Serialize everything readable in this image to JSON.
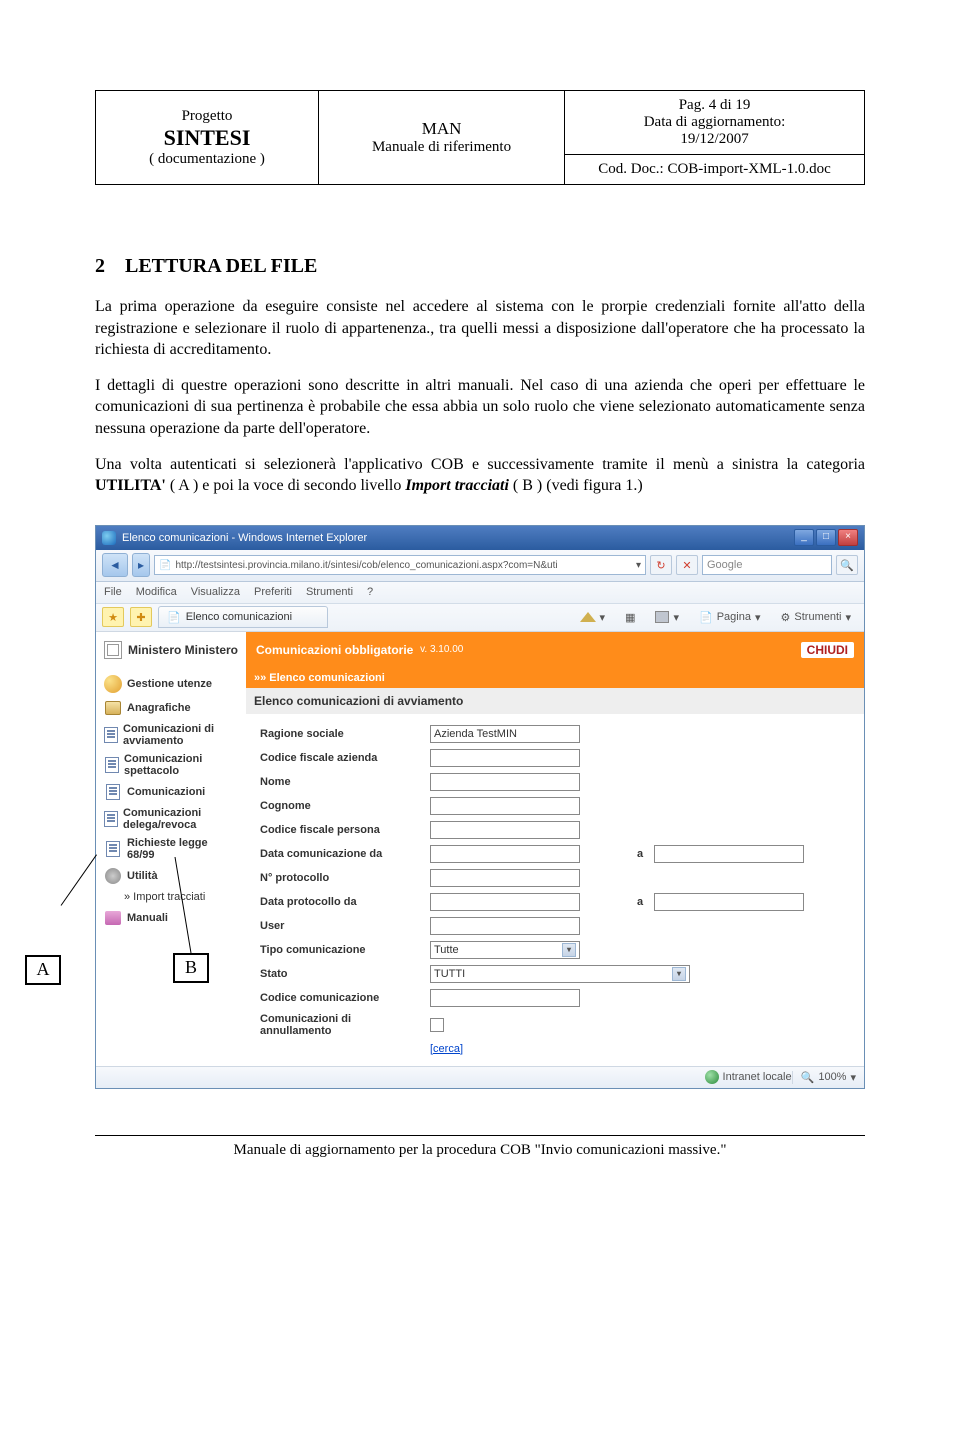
{
  "header": {
    "project_label": "Progetto",
    "project_name": "SINTESI",
    "project_sub": "( documentazione )",
    "man": "MAN",
    "man_sub": "Manuale di riferimento",
    "page": "Pag. 4 di 19",
    "update_label": "Data di aggiornamento:",
    "update_date": "19/12/2007",
    "code": "Cod. Doc.: COB-import-XML-1.0.doc"
  },
  "section": {
    "num": "2",
    "title": "LETTURA DEL FILE"
  },
  "paragraphs": {
    "p1": "La prima operazione da eseguire consiste nel accedere al sistema con le prorpie credenziali fornite all'atto della registrazione e selezionare il ruolo di appartenenza., tra quelli messi a disposizione dall'operatore che ha processato la richiesta di accreditamento.",
    "p2a": "I dettagli di questre operazioni sono descritte in altri manuali. Nel caso di una azienda che operi per effettuare le comunicazioni di sua pertinenza è probabile che essa abbia un solo ruolo che viene selezionato automaticamente senza nessuna operazione da parte dell'operatore.",
    "p3_pre": "Una volta autenticati si selezionerà l'applicativo COB e successivamente tramite il menù a sinistra la categoria ",
    "p3_b1": "UTILITA'",
    "p3_mid1": " ( A )  e poi la voce di secondo livello ",
    "p3_b2": "Import tracciati",
    "p3_mid2": " ( B ) (vedi figura 1.)"
  },
  "browser": {
    "title": "Elenco comunicazioni - Windows Internet Explorer",
    "url": "http://testsintesi.provincia.milano.it/sintesi/cob/elenco_comunicazioni.aspx?com=N&uti",
    "search_placeholder": "Google",
    "menus": [
      "File",
      "Modifica",
      "Visualizza",
      "Preferiti",
      "Strumenti",
      "?"
    ],
    "tab": "Elenco comunicazioni",
    "toolbar": {
      "pagina": "Pagina",
      "strumenti": "Strumenti"
    },
    "status": {
      "zone": "Intranet locale",
      "zoom": "100%"
    }
  },
  "app": {
    "logo": "Ministero Ministero",
    "header": "Comunicazioni obbligatorie",
    "version_label": "v.",
    "version": "3.10.00",
    "close": "CHIUDI",
    "breadcrumb": "»» Elenco comunicazioni",
    "sub": "Elenco comunicazioni di avviamento",
    "sidebar": [
      "Gestione utenze",
      "Anagrafiche",
      "Comunicazioni di avviamento",
      "Comunicazioni spettacolo",
      "Comunicazioni",
      "Comunicazioni delega/revoca",
      "Richieste legge 68/99",
      "Utilità",
      "Manuali"
    ],
    "sidebar_sub": "» Import tracciati",
    "form": {
      "ragione": "Ragione sociale",
      "ragione_val": "Azienda TestMIN",
      "cfa": "Codice fiscale azienda",
      "nome": "Nome",
      "cognome": "Cognome",
      "cfp": "Codice fiscale persona",
      "data_com": "Data comunicazione da",
      "a": "a",
      "nprot": "N° protocollo",
      "data_prot": "Data protocollo da",
      "user": "User",
      "tipo": "Tipo comunicazione",
      "tipo_val": "Tutte",
      "stato": "Stato",
      "stato_val": "TUTTI",
      "cod": "Codice comunicazione",
      "ann": "Comunicazioni di annullamento",
      "cerca": "[cerca]"
    }
  },
  "callouts": {
    "a": "A",
    "b": "B"
  },
  "footer": "Manuale di aggiornamento per la procedura COB  \"Invio comunicazioni massive.\""
}
